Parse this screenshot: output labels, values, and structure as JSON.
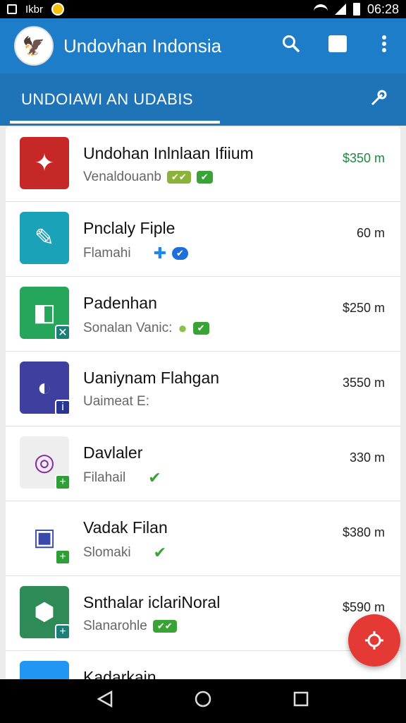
{
  "status_bar": {
    "left_text": "Ikbr",
    "time": "06:28",
    "icons": [
      "notification-box-icon",
      "photo-icon",
      "wallet-icon",
      "wifi-icon",
      "signal-icon",
      "battery-icon"
    ]
  },
  "app_bar": {
    "title": "Undovhan Indonsia",
    "logo_icon": "garuda-emblem-icon",
    "actions": [
      "search-icon",
      "chat-icon",
      "more-vert-icon"
    ],
    "color": "#1e7dc8"
  },
  "tab_bar": {
    "label": "UNDOIAWI AN UDABIS",
    "action_icon": "tool-icon",
    "color": "#1f74b8"
  },
  "list": {
    "items": [
      {
        "title": "Undohan Inlnlaan Ifiium",
        "subtitle": "Venaldouanb",
        "price": "$350 m",
        "icon_color": "#c62828",
        "icon_glyph": "✦"
      },
      {
        "title": "Pnclaly Fiple",
        "subtitle": "Flamahi",
        "price": "60 m",
        "icon_color": "#1aa3b8",
        "icon_glyph": "✎"
      },
      {
        "title": "Padenhan",
        "subtitle": "Sonalan Vanic:",
        "price": "$250 m",
        "icon_color": "#26a65b",
        "icon_glyph": "◧"
      },
      {
        "title": "Uaniynam Flahgan",
        "subtitle": "Uaimeat E:",
        "price": "3550 m",
        "icon_color": "#3f3fa0",
        "icon_glyph": "◐"
      },
      {
        "title": "Davlaler",
        "subtitle": "Filahail",
        "price": "330 m",
        "icon_color": "#eeeeee",
        "icon_glyph": "◎"
      },
      {
        "title": "Vadak Filan",
        "subtitle": "Slomaki",
        "price": "$380 m",
        "icon_color": "#ffffff",
        "icon_glyph": "▣"
      },
      {
        "title": "Snthalar iclariNoral",
        "subtitle": "Slanarohle",
        "price": "$590 m",
        "icon_color": "#2e8b57",
        "icon_glyph": "⬢"
      },
      {
        "title": "Kadarkain",
        "subtitle": "",
        "price": "",
        "icon_color": "#2196f3",
        "icon_glyph": "●"
      }
    ]
  },
  "fab": {
    "icon": "navigation-target-icon",
    "color": "#e53935"
  },
  "nav_bar": {
    "buttons": [
      "back-icon",
      "home-icon",
      "recents-icon"
    ]
  }
}
